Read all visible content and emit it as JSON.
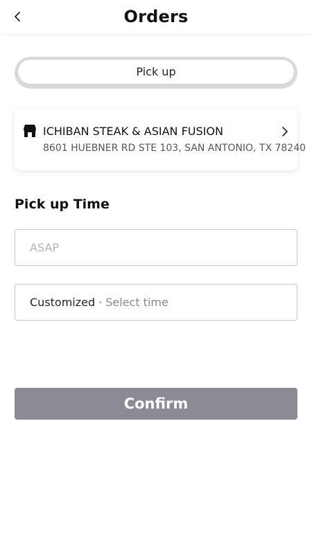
{
  "header": {
    "title": "Orders",
    "back_icon": "chevron-left-icon"
  },
  "mode_toggle": {
    "selected": "Pick up"
  },
  "store": {
    "icon": "store-icon",
    "name": "ICHIBAN STEAK & ASIAN FUSION",
    "address": "8601 HUEBNER RD STE 103, SAN ANTONIO, TX 78240",
    "chevron_icon": "chevron-right-icon"
  },
  "pickup_time": {
    "title": "Pick up Time",
    "asap_label": "ASAP",
    "customized_label": "Customized",
    "separator": "·",
    "select_time_hint": "Select time"
  },
  "confirm_button": {
    "label": "Confirm",
    "color": "#8a8b93"
  }
}
